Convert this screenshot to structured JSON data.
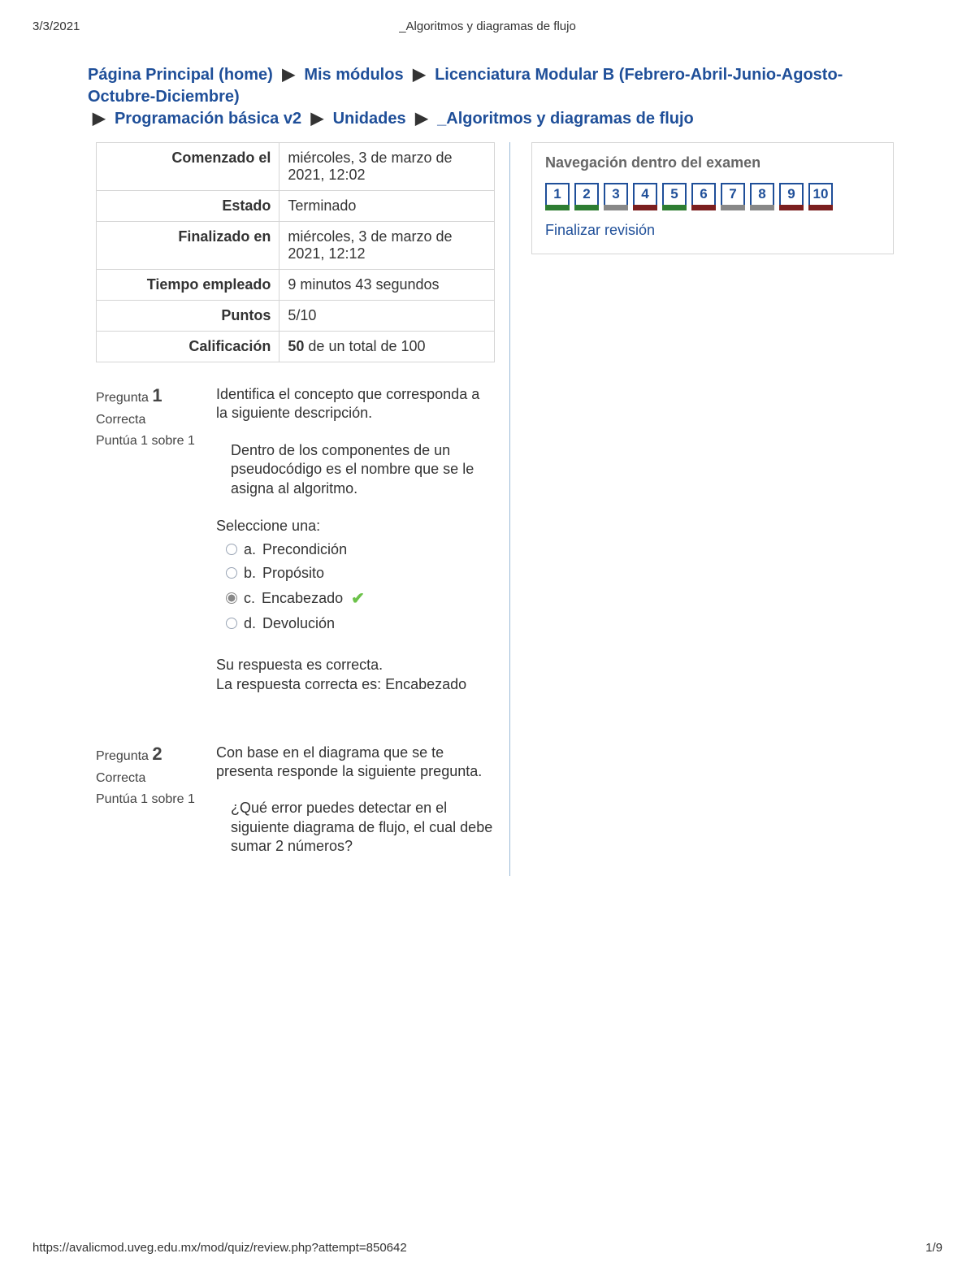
{
  "print": {
    "date": "3/3/2021",
    "title": "_Algoritmos y diagramas de flujo",
    "url": "https://avalicmod.uveg.edu.mx/mod/quiz/review.php?attempt=850642",
    "page": "1/9"
  },
  "breadcrumb": {
    "items": [
      "Página Principal (home)",
      "Mis módulos",
      "Licenciatura Modular B (Febrero-Abril-Junio-Agosto-Octubre-Diciembre)",
      "Programación básica v2",
      "Unidades",
      "_Algoritmos y diagramas de flujo"
    ]
  },
  "info": {
    "rows": [
      {
        "label": "Comenzado el",
        "value": "miércoles, 3 de marzo de 2021, 12:02"
      },
      {
        "label": "Estado",
        "value": "Terminado"
      },
      {
        "label": "Finalizado en",
        "value": "miércoles, 3 de marzo de 2021, 12:12"
      },
      {
        "label": "Tiempo empleado",
        "value": "9 minutos 43 segundos"
      },
      {
        "label": "Puntos",
        "value": "5/10"
      },
      {
        "label": "Calificación",
        "value_bold": "50",
        "value_rest": " de un total de 100"
      }
    ]
  },
  "questions": [
    {
      "label": "Pregunta",
      "num": "1",
      "status": "Correcta",
      "points": "Puntúa 1 sobre 1",
      "prompt": "Identifica el concepto que corresponda a la siguiente descripción.",
      "detail": "Dentro de los componentes de un pseudocódigo es el nombre que se le asigna al algoritmo.",
      "select_label": "Seleccione una:",
      "options": [
        {
          "letter": "a.",
          "text": "Precondición",
          "selected": false,
          "correct": false
        },
        {
          "letter": "b.",
          "text": "Propósito",
          "selected": false,
          "correct": false
        },
        {
          "letter": "c.",
          "text": "Encabezado",
          "selected": true,
          "correct": true
        },
        {
          "letter": "d.",
          "text": "Devolución",
          "selected": false,
          "correct": false
        }
      ],
      "feedback1": "Su respuesta es correcta.",
      "feedback2": "La respuesta correcta es: Encabezado"
    },
    {
      "label": "Pregunta",
      "num": "2",
      "status": "Correcta",
      "points": "Puntúa 1 sobre 1",
      "prompt": "Con base en el diagrama que se te presenta responde la siguiente pregunta.",
      "detail": "¿Qué error puedes detectar en el siguiente diagrama de flujo, el cual debe sumar 2 números?"
    }
  ],
  "nav": {
    "title": "Navegación dentro del examen",
    "items": [
      {
        "n": "1",
        "state": "correct"
      },
      {
        "n": "2",
        "state": "correct"
      },
      {
        "n": "3",
        "state": "neutral"
      },
      {
        "n": "4",
        "state": "incorrect"
      },
      {
        "n": "5",
        "state": "correct"
      },
      {
        "n": "6",
        "state": "incorrect"
      },
      {
        "n": "7",
        "state": "neutral"
      },
      {
        "n": "8",
        "state": "neutral"
      },
      {
        "n": "9",
        "state": "incorrect"
      },
      {
        "n": "10",
        "state": "incorrect"
      }
    ],
    "finish": "Finalizar revisión"
  }
}
